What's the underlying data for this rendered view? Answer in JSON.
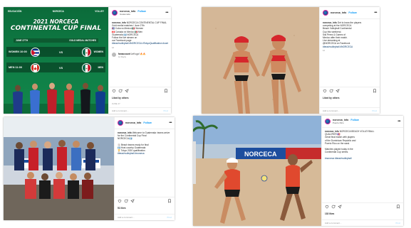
{
  "posts": [
    {
      "username": "norceca_info",
      "follow_label": "Follow",
      "location": "Guatemala",
      "media": {
        "sponsors": [
          "EDUCACIÓN",
          "NORCECA",
          "VOLLEY"
        ],
        "title_line1": "2021 NORCECA",
        "title_line2": "CONTINENTAL CUP FINAL",
        "date_label": "JUNE 27TH",
        "event_label": "GOLD MEDAL MATCHES",
        "match1_label": "WOMEN 10:00",
        "match1_result": "WOMEN",
        "match2_label": "MEN 11:00",
        "match2_result": "MEN",
        "vs": "VS"
      },
      "caption_lines": [
        "NORCECA CONTINENTAL CUP FINAL",
        "Gold medal matches / June 27th",
        "🇨🇺 Cuba vs Mexico 🇲🇽 Women",
        "🇨🇦 Canada vs Mexico 🇲🇽 Men",
        "Guatemala 🇬🇹 NORCECA",
        "Follow the live stream on",
        "our Facebook page"
      ],
      "hashtags": "#beachvolleyball #NORCECA #TokyoQualification #continentalcup",
      "time": "1d",
      "comment_user": "fanaccount",
      "comment_text": "Let's go! 🔥🔥",
      "comment_sub": "1d   Reply",
      "likes": "Liked by others",
      "date": "JUNE 27",
      "add_comment": "Add a comment...",
      "post_label": "Post"
    },
    {
      "username": "norceca_info",
      "follow_label": "Follow",
      "location": "",
      "caption_lines": [
        "Get to know the players",
        "competing at the NORCECA",
        "Beach Volleyball Continental",
        "Cup this weekend.",
        "Sisi Perez & Gomez of",
        "Mexico after their match.",
        "Live streaming at",
        "@NORCECA on Facebook"
      ],
      "hashtags": "#beachvolleyball #NORCECA",
      "time": "1d",
      "likes": "Liked by others",
      "date": "",
      "add_comment": "Add a comment...",
      "post_label": "Post"
    },
    {
      "username": "norceca_info",
      "follow_label": "Follow",
      "location": "",
      "caption_lines": [
        "Welcome to Guatemala: teams arrive",
        "for the Continental Cup Final",
        "NORCECA 🇬🇹",
        "",
        "🏐 Beach teams ready for final",
        "🇬🇹 Host country Guatemala",
        "🏆 Tokyo 2020 qualification"
      ],
      "hashtags": "#beachvolleyball #norceca",
      "time": "",
      "likes": "51 likes",
      "date": "",
      "add_comment": "Add a comment...",
      "post_label": "Post"
    },
    {
      "username": "norceca_info",
      "follow_label": "Follow",
      "location": "Puerto Rico",
      "caption_lines": [
        "NORCECA BEACH VOLLEYBALL",
        "QUALIFIER 🇵🇷",
        "Great final match with players",
        "of the Dominican Republic and",
        "Puerto Rico on the sand.",
        "",
        "Matches played today in the",
        "Continental Cup series.",
        "",
        "#norceca #beachvolleyball"
      ],
      "hashtags": "#beachvolleyball #norceca",
      "time": "",
      "likes": "133 likes",
      "date": "",
      "add_comment": "Add a comment...",
      "post_label": "Post"
    }
  ],
  "colors": {
    "instagram_blue": "#0095f6",
    "poster_green": "#0f7b44"
  },
  "icons": [
    "heart-icon",
    "comment-icon",
    "share-icon",
    "bookmark-icon",
    "more-icon"
  ]
}
